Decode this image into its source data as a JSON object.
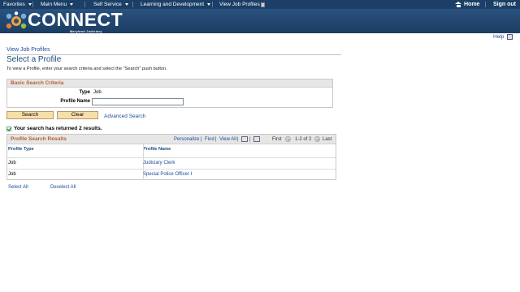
{
  "menubar": {
    "favorites": "Favorites",
    "main_menu": "Main Menu",
    "self_service": "Self Service",
    "learning": "Learning and Development",
    "current_page": "View Job Profiles",
    "home": "Home",
    "sign_out": "Sign out"
  },
  "banner": {
    "logo": "CONNECT",
    "sub": "Maryland Judiciary"
  },
  "help": {
    "label": "Help"
  },
  "breadcrumb": "View Job Profiles",
  "page": {
    "title": "Select a Profile",
    "instructions": "To view a Profile, enter your search criteria and select the \"Search\" push button."
  },
  "search": {
    "header": "Basic Search Criteria",
    "type_label": "Type",
    "type_value": "Job",
    "profile_name_label": "Profile Name",
    "profile_name_value": "",
    "search_button": "Search",
    "clear_button": "Clear",
    "advanced_link": "Advanced Search"
  },
  "results": {
    "message": "Your search has returned 2 results.",
    "title": "Profile Search Results",
    "personalize": "Personalize",
    "find": "Find",
    "view_all": "View All",
    "first": "First",
    "range": "1-2 of 2",
    "last": "Last",
    "columns": [
      "Profile Type",
      "Profile Name"
    ],
    "rows": [
      {
        "type": "Job",
        "name": "Judiciary Clerk"
      },
      {
        "type": "Job",
        "name": "Special Police Officer I"
      }
    ],
    "select_all": "Select All",
    "deselect_all": "Deselect All"
  }
}
